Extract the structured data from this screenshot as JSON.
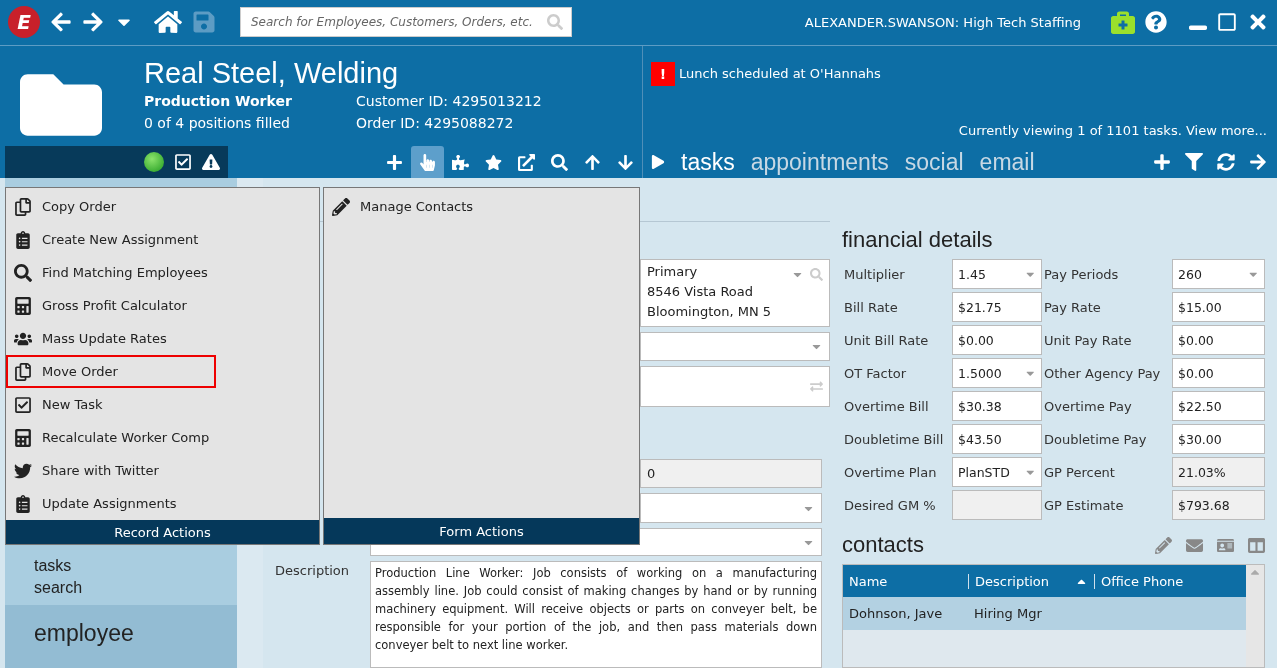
{
  "topbar": {
    "logo": "E",
    "search": {
      "placeholder": "Search for Employees, Customers, Orders, etc."
    },
    "user": "ALEXANDER.SWANSON: High Tech Staffing"
  },
  "record": {
    "title": "Real Steel, Welding",
    "subtitle": "Production Worker",
    "positions": "0 of 4 positions filled",
    "customer_id": "Customer ID: 4295013212",
    "order_id": "Order ID: 4295088272"
  },
  "record_toolbar": [
    {
      "kind": "add",
      "selected": false
    },
    {
      "kind": "actions",
      "selected": true
    },
    {
      "kind": "puzzle",
      "selected": false
    },
    {
      "kind": "favorite",
      "selected": false
    },
    {
      "kind": "open",
      "selected": false
    },
    {
      "kind": "search",
      "selected": false
    },
    {
      "kind": "up",
      "selected": false
    },
    {
      "kind": "down",
      "selected": false
    }
  ],
  "alert": {
    "badge": "!",
    "text": "Lunch scheduled at O'Hannahs"
  },
  "task_count": "Currently viewing 1 of 1101 tasks. View more...",
  "panel_tabs": [
    {
      "label": "tasks",
      "selected": true
    },
    {
      "label": "appointments",
      "selected": false
    },
    {
      "label": "social",
      "selected": false
    },
    {
      "label": "email",
      "selected": false
    }
  ],
  "record_actions": {
    "title": "Record Actions",
    "items": [
      {
        "label": "Copy Order",
        "highlighted": false
      },
      {
        "label": "Create New Assignment",
        "highlighted": false
      },
      {
        "label": "Find Matching Employees",
        "highlighted": false
      },
      {
        "label": "Gross Profit Calculator",
        "highlighted": false
      },
      {
        "label": "Mass Update Rates",
        "highlighted": false
      },
      {
        "label": "Move Order",
        "highlighted": true
      },
      {
        "label": "New Task",
        "highlighted": false
      },
      {
        "label": "Recalculate Worker Comp",
        "highlighted": false
      },
      {
        "label": "Share with Twitter",
        "highlighted": false
      },
      {
        "label": "Update Assignments",
        "highlighted": false
      }
    ]
  },
  "form_actions": {
    "title": "Form Actions",
    "items": [
      {
        "label": "Manage Contacts"
      }
    ]
  },
  "sidebar": {
    "items": [
      {
        "label": "tasks"
      },
      {
        "label": "search"
      }
    ],
    "section": "employee"
  },
  "order_fields": {
    "address": [
      "Primary",
      "8546 Vista Road",
      "Bloomington, MN 5"
    ],
    "worksite_value": "0",
    "description": {
      "label": "Description",
      "text": "Production Line Worker: Job consists of working on a manufacturing assembly line. Job could consist of making changes by hand or by running machinery equipment. Will receive objects or parts on conveyer belt, be responsible for your portion of the job, and then pass materials down conveyer belt to next line worker."
    }
  },
  "financial": {
    "title": "financial details",
    "fields": [
      {
        "label": "Multiplier",
        "value": "1.45",
        "kind": "dropdown"
      },
      {
        "label": "Pay Periods",
        "value": "260",
        "kind": "dropdown"
      },
      {
        "label": "Bill Rate",
        "value": "$21.75",
        "kind": "text"
      },
      {
        "label": "Pay Rate",
        "value": "$15.00",
        "kind": "text"
      },
      {
        "label": "Unit Bill Rate",
        "value": "$0.00",
        "kind": "text"
      },
      {
        "label": "Unit Pay Rate",
        "value": "$0.00",
        "kind": "text"
      },
      {
        "label": "OT Factor",
        "value": "1.5000",
        "kind": "dropdown"
      },
      {
        "label": "Other Agency Pay",
        "value": "$0.00",
        "kind": "text"
      },
      {
        "label": "Overtime Bill",
        "value": "$30.38",
        "kind": "text"
      },
      {
        "label": "Overtime Pay",
        "value": "$22.50",
        "kind": "text"
      },
      {
        "label": "Doubletime Bill",
        "value": "$43.50",
        "kind": "text"
      },
      {
        "label": "Doubletime Pay",
        "value": "$30.00",
        "kind": "text"
      },
      {
        "label": "Overtime Plan",
        "value": "PlanSTD",
        "kind": "dropdown"
      },
      {
        "label": "GP Percent",
        "value": "21.03%",
        "kind": "readonly"
      },
      {
        "label": "Desired GM %",
        "kind": "readonly"
      },
      {
        "label": "GP Estimate",
        "value": "$793.68",
        "kind": "readonly"
      }
    ]
  },
  "contacts": {
    "title": "contacts",
    "columns": [
      {
        "label": "Name",
        "sorted": false
      },
      {
        "label": "Description",
        "sorted": true
      },
      {
        "label": "Office Phone",
        "sorted": false
      }
    ],
    "rows": [
      {
        "cells": [
          "Dohnson, Jave",
          "Hiring Mgr"
        ],
        "selected": true
      }
    ]
  }
}
